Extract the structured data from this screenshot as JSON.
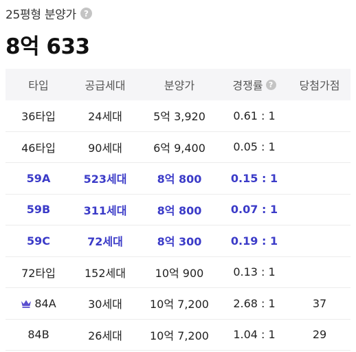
{
  "header": {
    "subtitle": "25평형 분양가",
    "help_icon": "?",
    "price": "8억 633"
  },
  "table": {
    "columns": [
      "타입",
      "공급세대",
      "분양가",
      "경쟁률",
      "당첨가점"
    ],
    "competition_help_icon": "?",
    "rows": [
      {
        "type": "36타입",
        "units": "24세대",
        "price": "5억 3,920",
        "ratio": "0.61 : 1",
        "score": "",
        "highlight": false,
        "crown": false
      },
      {
        "type": "46타입",
        "units": "90세대",
        "price": "6억 9,400",
        "ratio": "0.05 : 1",
        "score": "",
        "highlight": false,
        "crown": false
      },
      {
        "type": "59A",
        "units": "523세대",
        "price": "8억 800",
        "ratio": "0.15 : 1",
        "score": "",
        "highlight": true,
        "crown": false
      },
      {
        "type": "59B",
        "units": "311세대",
        "price": "8억 800",
        "ratio": "0.07 : 1",
        "score": "",
        "highlight": true,
        "crown": false
      },
      {
        "type": "59C",
        "units": "72세대",
        "price": "8억 300",
        "ratio": "0.19 : 1",
        "score": "",
        "highlight": true,
        "crown": false
      },
      {
        "type": "72타입",
        "units": "152세대",
        "price": "10억 900",
        "ratio": "0.13 : 1",
        "score": "",
        "highlight": false,
        "crown": false
      },
      {
        "type": "84A",
        "units": "30세대",
        "price": "10억 7,200",
        "ratio": "2.68 : 1",
        "score": "37",
        "highlight": false,
        "crown": true
      },
      {
        "type": "84B",
        "units": "26세대",
        "price": "10억 7,200",
        "ratio": "1.04 : 1",
        "score": "29",
        "highlight": false,
        "crown": false
      }
    ]
  },
  "colors": {
    "highlight": "#3b3bc8",
    "header_bg": "#f5f5f7",
    "crown": "#5a4fcf"
  },
  "icons": {
    "crown_row": "crown-icon",
    "help": "question-circle-icon"
  }
}
